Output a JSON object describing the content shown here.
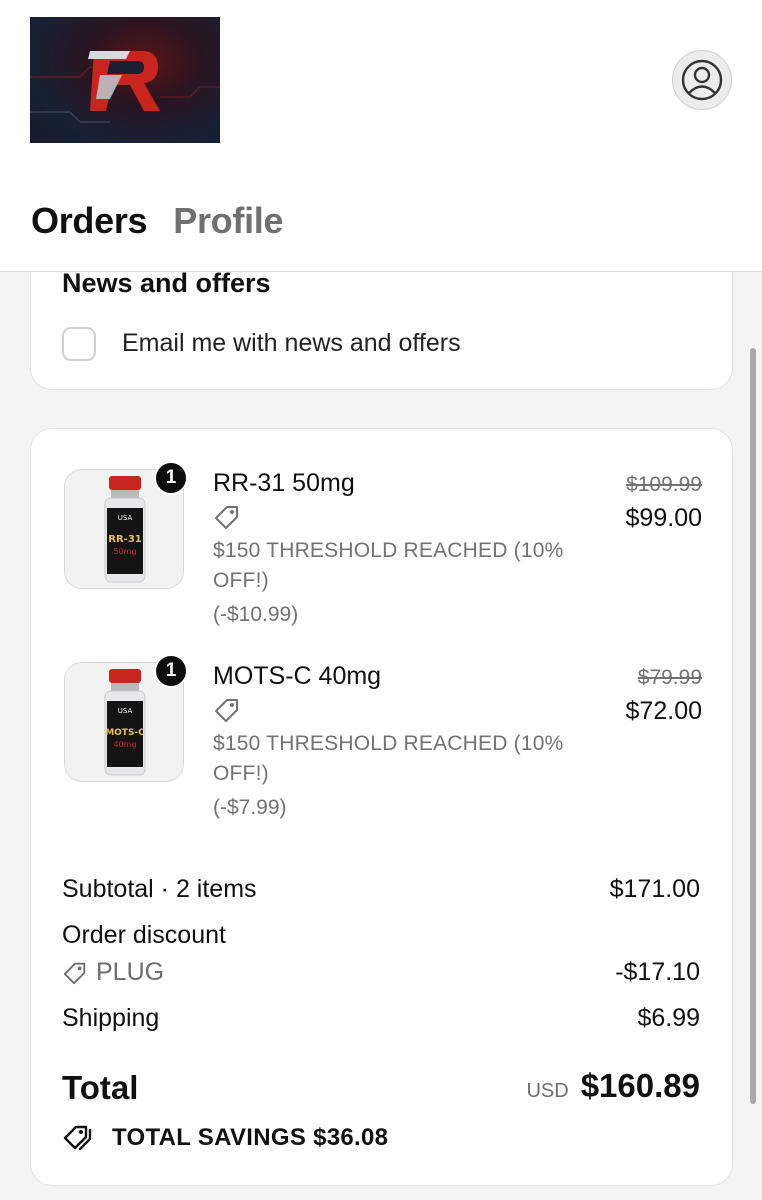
{
  "header": {
    "logo_alt": "R",
    "tabs": [
      {
        "label": "Orders",
        "active": true
      },
      {
        "label": "Profile",
        "active": false
      }
    ]
  },
  "news": {
    "title": "News and offers",
    "checkbox_label": "Email me with news and offers",
    "checked": false
  },
  "order": {
    "items": [
      {
        "quantity": "1",
        "name": "RR-31 50mg",
        "discount_name": "$150 THRESHOLD REACHED (10% OFF!)",
        "discount_amount": "(-$10.99)",
        "original_price": "$109.99",
        "price": "$99.00",
        "vial_label": "RR-31",
        "vial_dose": "50mg",
        "vial_brand": "USA"
      },
      {
        "quantity": "1",
        "name": "MOTS-C 40mg",
        "discount_name": "$150 THRESHOLD REACHED (10% OFF!)",
        "discount_amount": "(-$7.99)",
        "original_price": "$79.99",
        "price": "$72.00",
        "vial_label": "MOTS-C",
        "vial_dose": "40mg",
        "vial_brand": "USA"
      }
    ],
    "subtotal_label": "Subtotal · 2 items",
    "subtotal_value": "$171.00",
    "order_discount_label": "Order discount",
    "discount_code": "PLUG",
    "discount_value": "-$17.10",
    "shipping_label": "Shipping",
    "shipping_value": "$6.99",
    "total_label": "Total",
    "currency": "USD",
    "total_value": "$160.89",
    "savings_text": "TOTAL SAVINGS $36.08"
  },
  "colors": {
    "accent_red": "#c8251f",
    "text_primary": "#111111",
    "text_muted": "#727272",
    "card_bg": "#ffffff",
    "page_bg": "#f4f4f5"
  }
}
